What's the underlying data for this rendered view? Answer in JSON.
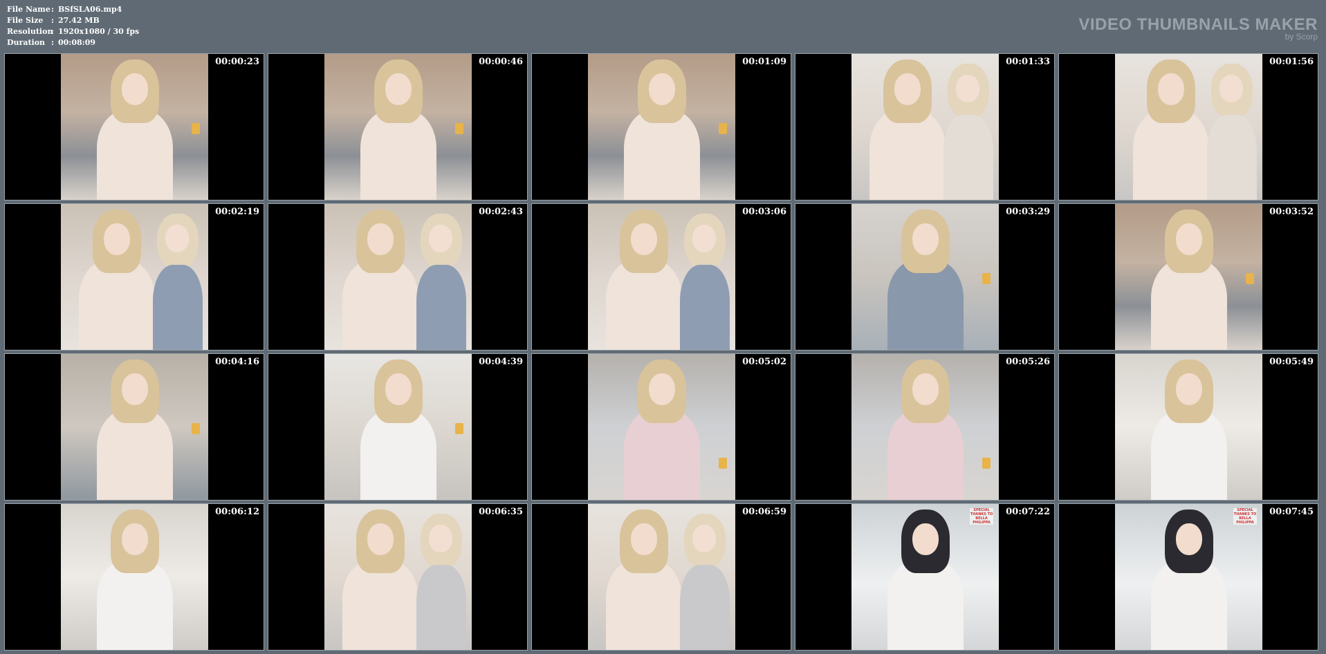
{
  "info": {
    "file_name_label": "File Name",
    "file_name_value": "BSfSLA06.mp4",
    "file_size_label": "File Size",
    "file_size_value": "27.42 MB",
    "resolution_label": "Resolution",
    "resolution_value": "1920x1080 / 30 fps",
    "duration_label": "Duration",
    "duration_value": "00:08:09",
    "separator": ":"
  },
  "brand": {
    "title": "VIDEO THUMBNAILS MAKER",
    "subtitle": "by Scorp"
  },
  "thumbnails": [
    {
      "time": "00:00:23",
      "scene": "a"
    },
    {
      "time": "00:00:46",
      "scene": "a"
    },
    {
      "time": "00:01:09",
      "scene": "a"
    },
    {
      "time": "00:01:33",
      "scene": "b"
    },
    {
      "time": "00:01:56",
      "scene": "b"
    },
    {
      "time": "00:02:19",
      "scene": "c"
    },
    {
      "time": "00:02:43",
      "scene": "c"
    },
    {
      "time": "00:03:06",
      "scene": "c"
    },
    {
      "time": "00:03:29",
      "scene": "d"
    },
    {
      "time": "00:03:52",
      "scene": "a"
    },
    {
      "time": "00:04:16",
      "scene": "e"
    },
    {
      "time": "00:04:39",
      "scene": "f"
    },
    {
      "time": "00:05:02",
      "scene": "g"
    },
    {
      "time": "00:05:26",
      "scene": "g"
    },
    {
      "time": "00:05:49",
      "scene": "h"
    },
    {
      "time": "00:06:12",
      "scene": "h"
    },
    {
      "time": "00:06:35",
      "scene": "b"
    },
    {
      "time": "00:06:59",
      "scene": "b"
    },
    {
      "time": "00:07:22",
      "scene": "i"
    },
    {
      "time": "00:07:45",
      "scene": "i"
    }
  ],
  "stamp_text": "SPECIAL THANKS TO BELLA PHILIPPA",
  "colors": {
    "background": "#5f6a74",
    "border": "#9aa3ab",
    "brand": "#9aa2a9"
  }
}
